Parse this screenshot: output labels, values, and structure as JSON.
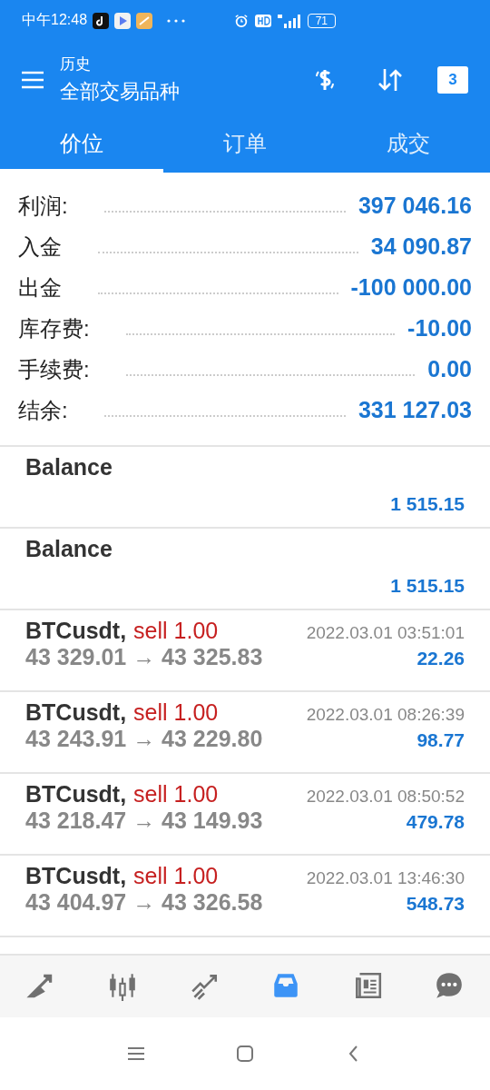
{
  "status_bar": {
    "time": "中午12:48",
    "battery": "71"
  },
  "toolbar": {
    "subtitle": "历史",
    "title": "全部交易品种",
    "calendar_day": "3"
  },
  "tabs": [
    {
      "label": "价位",
      "selected": true
    },
    {
      "label": "订单",
      "selected": false
    },
    {
      "label": "成交",
      "selected": false
    }
  ],
  "summary": [
    {
      "label": "利润:",
      "value": "397 046.16"
    },
    {
      "label": "入金",
      "value": "34 090.87"
    },
    {
      "label": "出金",
      "value": "-100 000.00"
    },
    {
      "label": "库存费:",
      "value": "-10.00"
    },
    {
      "label": "手续费:",
      "value": "0.00"
    },
    {
      "label": "结余:",
      "value": "331 127.03"
    }
  ],
  "entries": [
    {
      "kind": "balance",
      "title": "Balance",
      "amount": "1 515.15"
    },
    {
      "kind": "balance",
      "title": "Balance",
      "amount": "1 515.15"
    },
    {
      "kind": "deal",
      "symbol": "BTCusdt,",
      "side": "sell 1.00",
      "time": "2022.03.01 03:51:01",
      "prices": "43 329.01 → 43 325.83",
      "amount": "22.26"
    },
    {
      "kind": "deal",
      "symbol": "BTCusdt,",
      "side": "sell 1.00",
      "time": "2022.03.01 08:26:39",
      "prices": "43 243.91 → 43 229.80",
      "amount": "98.77"
    },
    {
      "kind": "deal",
      "symbol": "BTCusdt,",
      "side": "sell 1.00",
      "time": "2022.03.01 08:50:52",
      "prices": "43 218.47 → 43 149.93",
      "amount": "479.78"
    },
    {
      "kind": "deal",
      "symbol": "BTCusdt,",
      "side": "sell 1.00",
      "time": "2022.03.01 13:46:30",
      "prices": "43 404.97 → 43 326.58",
      "amount": "548.73"
    }
  ],
  "bottom_nav": [
    {
      "selected": false
    },
    {
      "selected": false
    },
    {
      "selected": false
    },
    {
      "selected": true
    },
    {
      "selected": false
    },
    {
      "selected": false
    }
  ]
}
